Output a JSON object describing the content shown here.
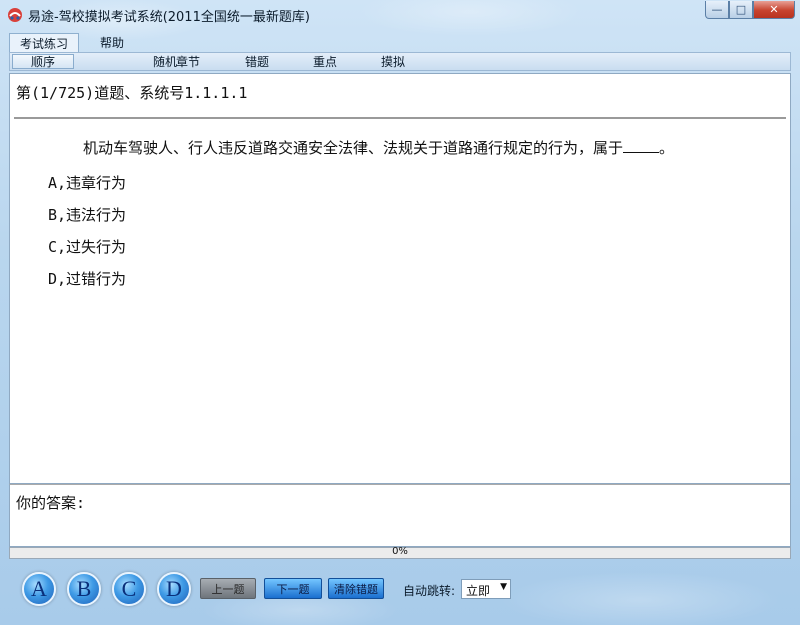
{
  "window": {
    "title": "易途-驾校摸拟考试系统(2011全国统一最新题库)",
    "controls": {
      "minimize": "—",
      "maximize": "□",
      "close": "✕"
    }
  },
  "menu": {
    "tabs": [
      "考试练习",
      "帮助"
    ],
    "active_tab": "考试练习"
  },
  "toolbar": {
    "items": [
      "顺序",
      "随机",
      "章节",
      "错题",
      "重点",
      "摸拟"
    ],
    "active_item": "顺序"
  },
  "question": {
    "header": "第(1/725)道题、系统号1.1.1.1",
    "text_before_blank": "机动车驾驶人、行人违反道路交通安全法律、法规关于道路通行规定的行为，属于",
    "text_after_blank": "。",
    "options": [
      "A,违章行为",
      "B,违法行为",
      "C,过失行为",
      "D,过错行为"
    ]
  },
  "answer": {
    "label": "你的答案:"
  },
  "progress": {
    "percent": 0,
    "text": "0%"
  },
  "controls": {
    "answer_buttons": [
      "A",
      "B",
      "C",
      "D"
    ],
    "prev_label": "上一题",
    "next_label": "下一题",
    "clear_label": "清除错题",
    "auto_jump_label": "自动跳转:",
    "auto_jump_value": "立即"
  },
  "colors": {
    "accent": "#1a6fcf",
    "progress_fill": "#4fa14f",
    "close_button": "#c7432f"
  }
}
